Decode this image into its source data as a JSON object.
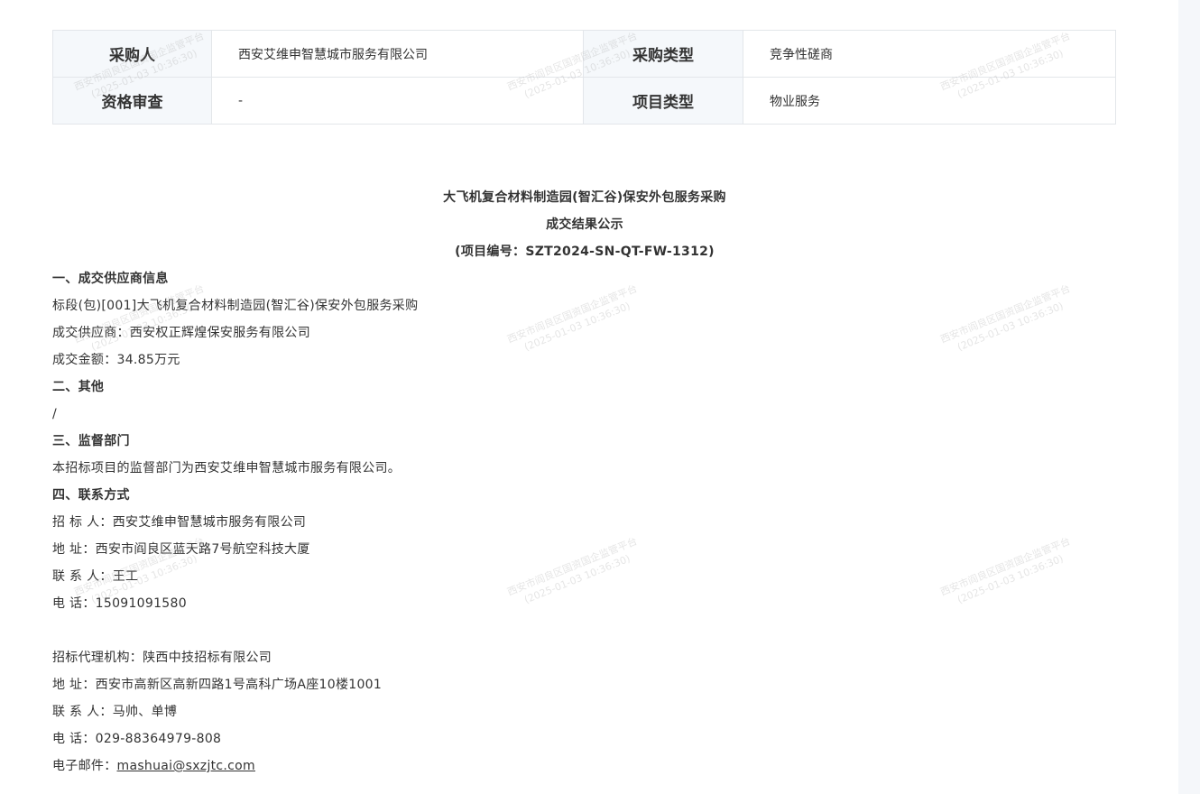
{
  "info_table": {
    "rows": [
      {
        "label1": "采购人",
        "value1": "西安艾维申智慧城市服务有限公司",
        "label2": "采购类型",
        "value2": "竞争性磋商"
      },
      {
        "label1": "资格审查",
        "value1": "-",
        "label2": "项目类型",
        "value2": "物业服务"
      }
    ]
  },
  "document": {
    "title_line1": "大飞机复合材料制造园(智汇谷)保安外包服务采购",
    "title_line2": "成交结果公示",
    "title_line3": "(项目编号：SZT2024-SN-QT-FW-1312)",
    "section1_heading": "一、成交供应商信息",
    "section1_lot": "标段(包)[001]大飞机复合材料制造园(智汇谷)保安外包服务采购",
    "section1_supplier": "成交供应商：西安权正辉煌保安服务有限公司",
    "section1_amount": "成交金额：34.85万元",
    "section2_heading": "二、其他",
    "section2_body": "/",
    "section3_heading": "三、监督部门",
    "section3_body": "本招标项目的监督部门为西安艾维申智慧城市服务有限公司。",
    "section4_heading": "四、联系方式",
    "tenderer": "招 标 人：西安艾维申智慧城市服务有限公司",
    "tenderer_address": "地 址：西安市阎良区蓝天路7号航空科技大厦",
    "tenderer_contact": "联 系 人：王工",
    "tenderer_phone": "电 话：15091091580",
    "agency": "招标代理机构：陕西中技招标有限公司",
    "agency_address": "地 址：西安市高新区高新四路1号高科广场A座10楼1001",
    "agency_contact": "联 系 人：马帅、单博",
    "agency_phone": "电 话：029-88364979-808",
    "email_label": "电子邮件：",
    "email": "mashuai@sxzjtc.com"
  },
  "watermark": {
    "line1": "西安市阎良区国资国企监管平台",
    "line2": "(2025-01-03 10:36:30)"
  }
}
